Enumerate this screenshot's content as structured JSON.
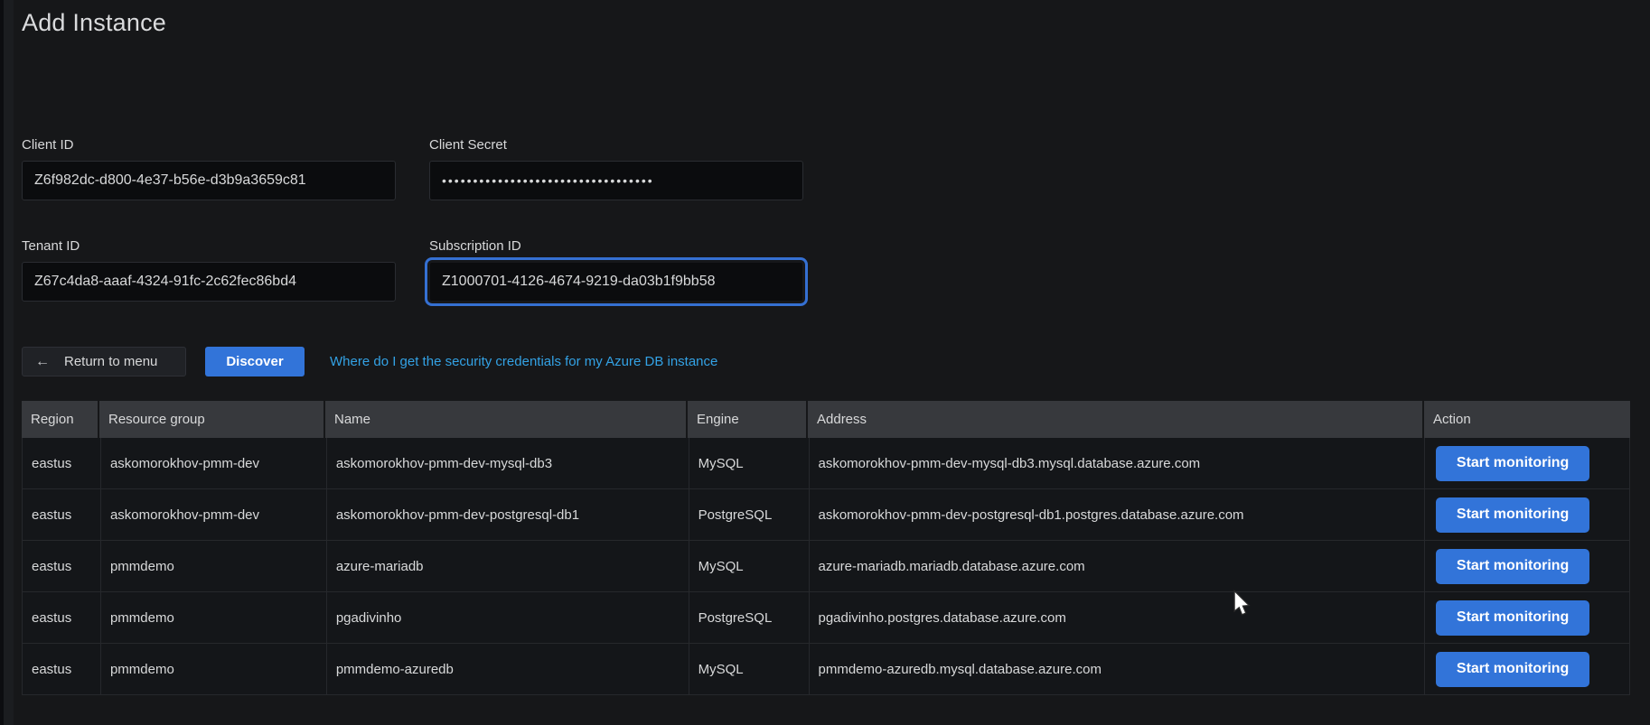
{
  "page": {
    "title": "Add Instance"
  },
  "form": {
    "fields": [
      {
        "label": "Client ID",
        "value": "Z6f982dc-d800-4e37-b56e-d3b9a3659c81"
      },
      {
        "label": "Client Secret",
        "value": "••••••••••••••••••••••••••••••••••"
      },
      {
        "label": "Tenant ID",
        "value": "Z67c4da8-aaaf-4324-91fc-2c62fec86bd4"
      },
      {
        "label": "Subscription ID",
        "value": "Z1000701-4126-4674-9219-da03b1f9bb58"
      }
    ]
  },
  "actions": {
    "return_icon": "←",
    "return_label": "Return to menu",
    "discover_label": "Discover",
    "help_link": "Where do I get the security credentials for my Azure DB instance"
  },
  "table": {
    "columns": [
      "Region",
      "Resource group",
      "Name",
      "Engine",
      "Address",
      "Action"
    ],
    "action_button_label": "Start monitoring",
    "rows": [
      {
        "region": "eastus",
        "resource_group": "askomorokhov-pmm-dev",
        "name": "askomorokhov-pmm-dev-mysql-db3",
        "engine": "MySQL",
        "address": "askomorokhov-pmm-dev-mysql-db3.mysql.database.azure.com"
      },
      {
        "region": "eastus",
        "resource_group": "askomorokhov-pmm-dev",
        "name": "askomorokhov-pmm-dev-postgresql-db1",
        "engine": "PostgreSQL",
        "address": "askomorokhov-pmm-dev-postgresql-db1.postgres.database.azure.com"
      },
      {
        "region": "eastus",
        "resource_group": "pmmdemo",
        "name": "azure-mariadb",
        "engine": "MySQL",
        "address": "azure-mariadb.mariadb.database.azure.com"
      },
      {
        "region": "eastus",
        "resource_group": "pmmdemo",
        "name": "pgadivinho",
        "engine": "PostgreSQL",
        "address": "pgadivinho.postgres.database.azure.com"
      },
      {
        "region": "eastus",
        "resource_group": "pmmdemo",
        "name": "pmmdemo-azuredb",
        "engine": "MySQL",
        "address": "pmmdemo-azuredb.mysql.database.azure.com"
      }
    ]
  },
  "colors": {
    "background": "#161719",
    "primary_button": "#3274d9",
    "link": "#33a2e5",
    "focus_ring": "#3570d2",
    "table_header_bg": "#37393d",
    "text": "#d8d9da"
  }
}
